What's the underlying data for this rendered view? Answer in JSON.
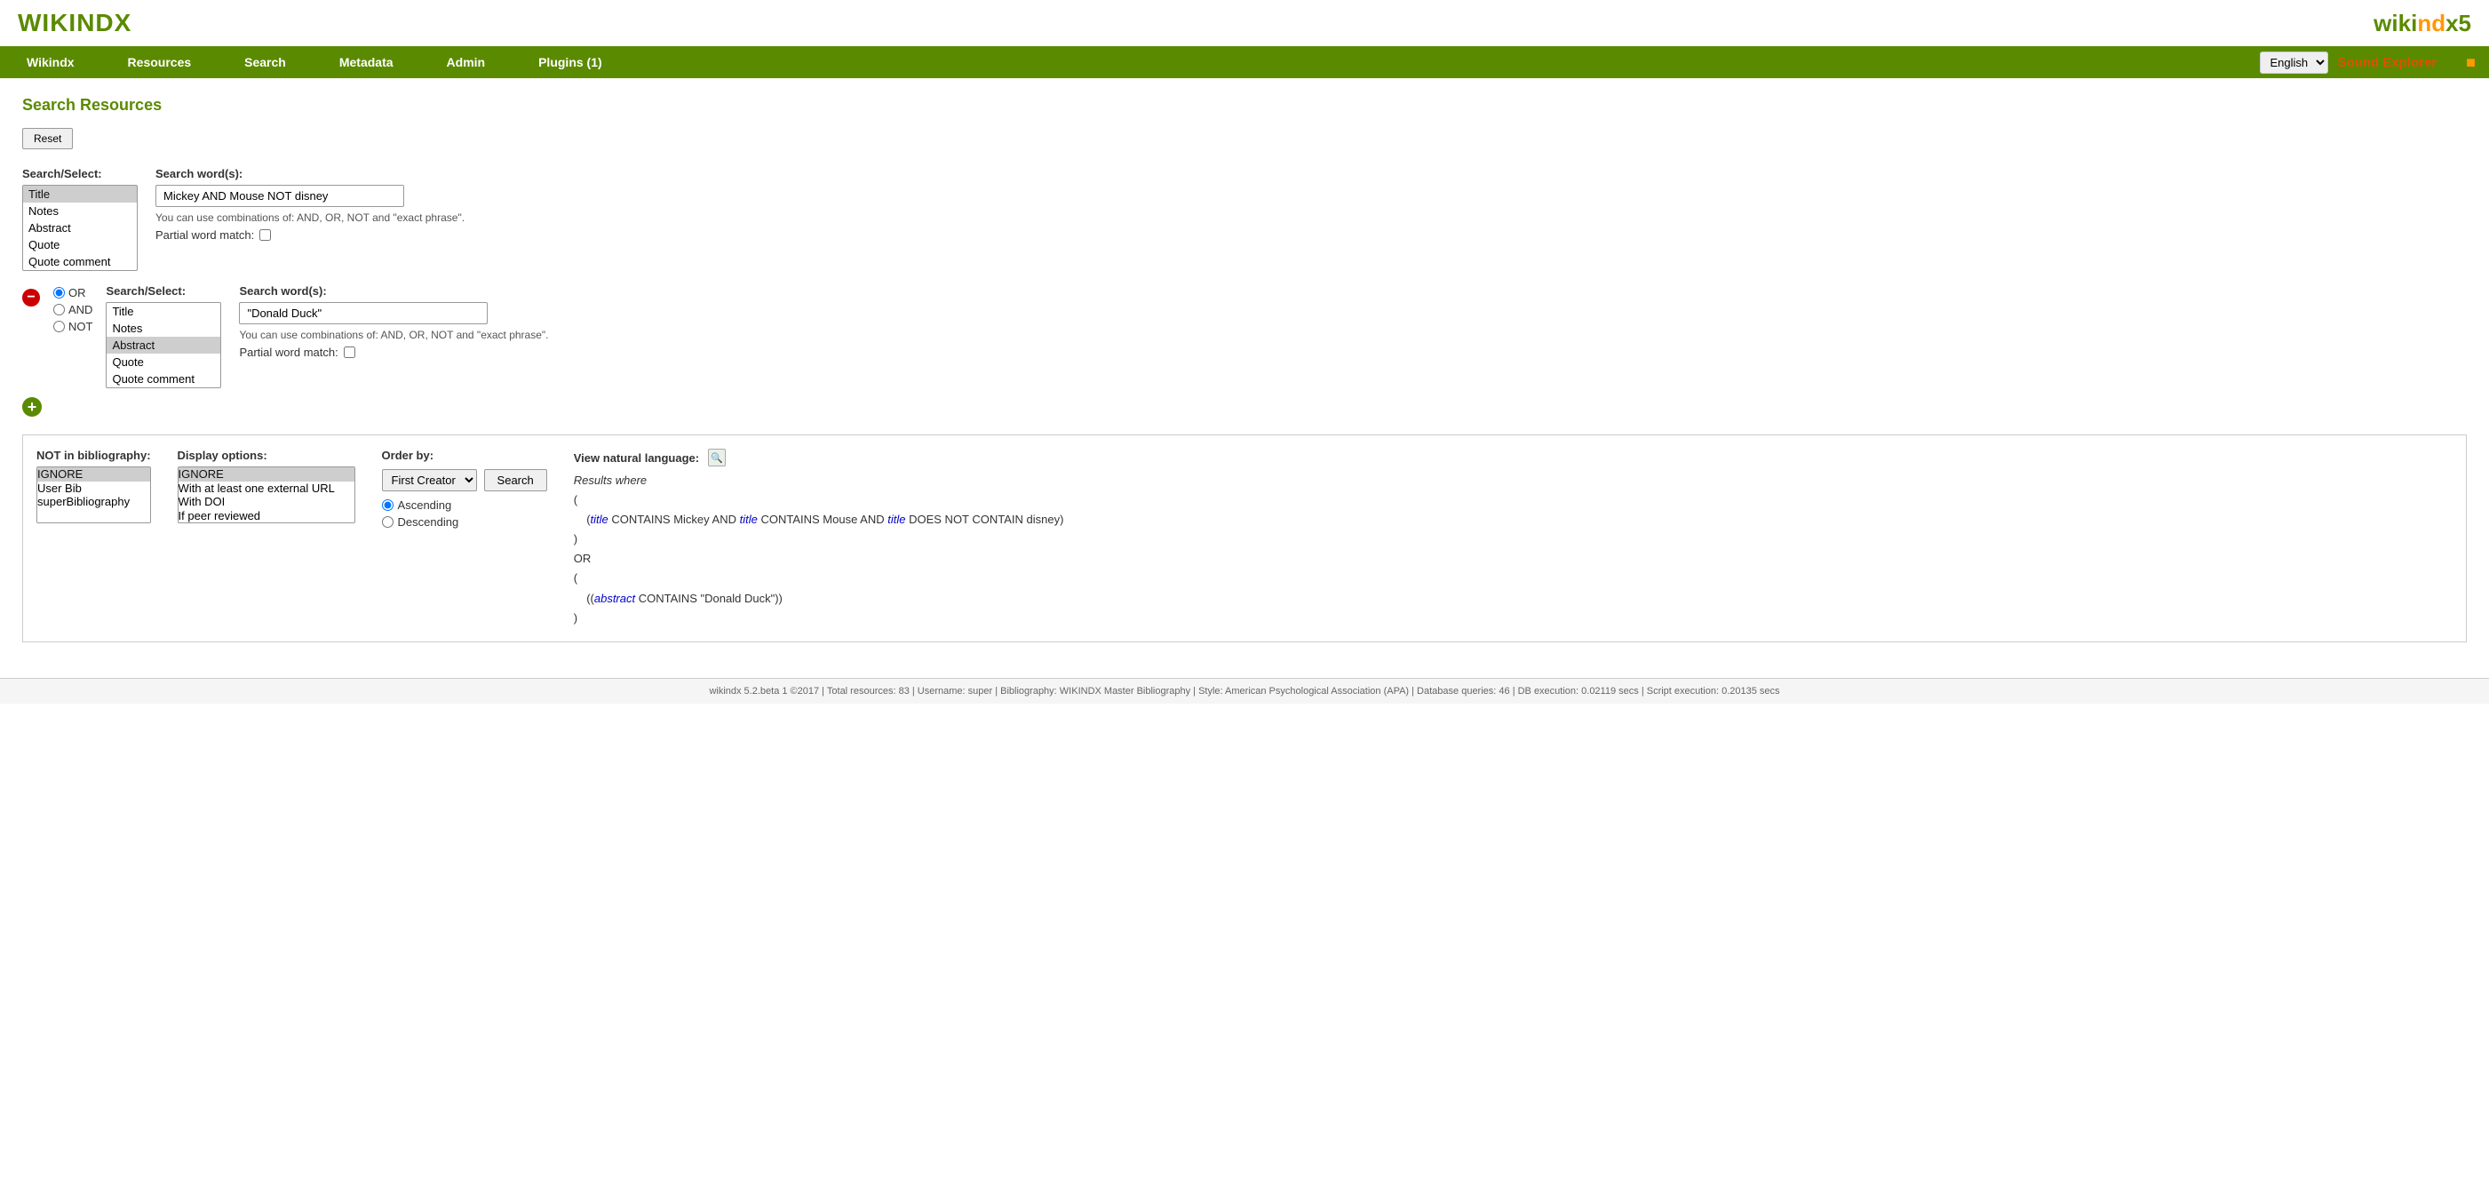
{
  "header": {
    "logo": "WIKINDX",
    "wikindx5": "wikindx5",
    "sound_explorer": "Sound Explorer"
  },
  "nav": {
    "items": [
      "Wikindx",
      "Resources",
      "Search",
      "Metadata",
      "Admin",
      "Plugins (1)"
    ],
    "language": "English"
  },
  "page": {
    "title": "Search Resources",
    "reset_label": "Reset"
  },
  "search1": {
    "select_label": "Search/Select:",
    "words_label": "Search word(s):",
    "input_value": "Mickey AND Mouse NOT disney",
    "hint": "You can use combinations of: AND, OR, NOT and \"exact phrase\".",
    "partial_label": "Partial word match:",
    "options": [
      "Title",
      "Notes",
      "Abstract",
      "Quote",
      "Quote comment"
    ]
  },
  "search2": {
    "select_label": "Search/Select:",
    "words_label": "Search word(s):",
    "input_value": "\"Donald Duck\"",
    "hint": "You can use combinations of: AND, OR, NOT and \"exact phrase\".",
    "partial_label": "Partial word match:",
    "options": [
      "Title",
      "Notes",
      "Abstract",
      "Quote",
      "Quote comment"
    ]
  },
  "boolean": {
    "options": [
      "OR",
      "AND",
      "NOT"
    ]
  },
  "bottom": {
    "not_in_bib_label": "NOT in bibliography:",
    "not_in_bib_options": [
      "IGNORE",
      "User Bib",
      "superBibliography"
    ],
    "display_opts_label": "Display options:",
    "display_opts_options": [
      "IGNORE",
      "With at least one external URL",
      "With DOI",
      "If peer reviewed"
    ],
    "order_by_label": "Order by:",
    "order_by_options": [
      "First Creator"
    ],
    "order_by_selected": "First Creator",
    "search_label": "Search",
    "asc_label": "Ascending",
    "desc_label": "Descending",
    "natural_lang_label": "View natural language:",
    "results_italic": "Results where",
    "results_line1": "(",
    "results_line2_pre": "    (",
    "results_line2_kw1": "title",
    "results_line2_mid1": " CONTAINS Mickey AND ",
    "results_line2_kw2": "title",
    "results_line2_mid2": " CONTAINS Mouse AND ",
    "results_line2_kw3": "title",
    "results_line2_end": " DOES NOT CONTAIN disney)",
    "results_line3": ")",
    "results_or": "OR",
    "results_line4": "(",
    "results_line5_pre": "    (",
    "results_line5_kw": "abstract",
    "results_line5_end": " CONTAINS \"Donald Duck\"))",
    "results_line6": ")"
  },
  "footer": {
    "text": "wikindx 5.2.beta 1 ©2017 | Total resources: 83 | Username: super | Bibliography: WIKINDX Master Bibliography | Style: American Psychological Association (APA) | Database queries: 46 | DB execution: 0.02119 secs | Script execution: 0.20135 secs"
  }
}
